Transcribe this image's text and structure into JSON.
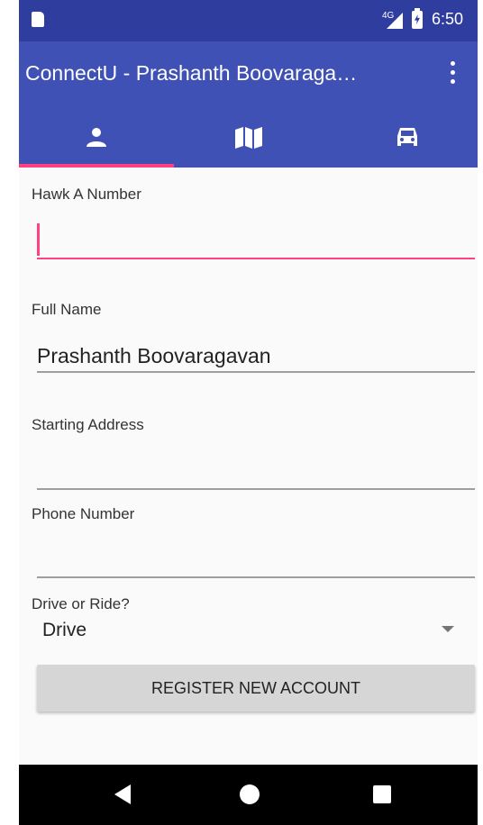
{
  "status_bar": {
    "network": "4G",
    "time": "6:50"
  },
  "app_bar": {
    "title": "ConnectU - Prashanth Boovaraga…"
  },
  "tabs": [
    {
      "icon": "person-icon",
      "selected": true
    },
    {
      "icon": "map-icon",
      "selected": false
    },
    {
      "icon": "car-icon",
      "selected": false
    }
  ],
  "form": {
    "hawk_label": "Hawk A Number",
    "hawk_value": "",
    "name_label": "Full Name",
    "name_value": "Prashanth Boovaragavan",
    "address_label": "Starting Address",
    "address_value": "",
    "phone_label": "Phone Number",
    "phone_value": "",
    "drive_label": "Drive or Ride?",
    "drive_value": "Drive",
    "register_label": "REGISTER NEW ACCOUNT"
  },
  "colors": {
    "primary": "#3f51b5",
    "primary_dark": "#2f3e9e",
    "accent": "#ff4081"
  }
}
